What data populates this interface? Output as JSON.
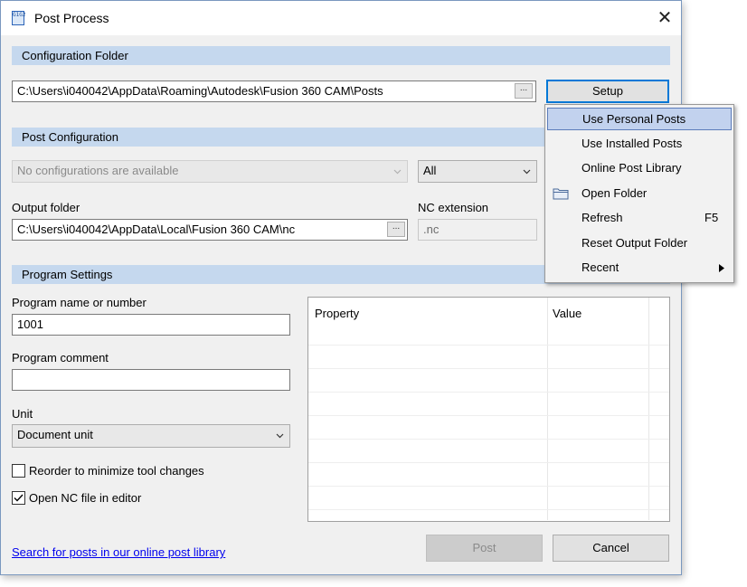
{
  "window": {
    "title": "Post Process",
    "close_glyph": "✕",
    "icon": "post-process-app-icon",
    "icon_text": "G1G2"
  },
  "config_folder": {
    "header": "Configuration Folder",
    "path": "C:\\Users\\i040042\\AppData\\Roaming\\Autodesk\\Fusion 360 CAM\\Posts",
    "browse_label": "...",
    "setup_label": "Setup"
  },
  "post_config": {
    "header": "Post Configuration",
    "config_select": "No configurations are available",
    "filter_select": "All",
    "output_folder_label": "Output folder",
    "output_folder": "C:\\Users\\i040042\\AppData\\Local\\Fusion 360 CAM\\nc",
    "browse_label": "...",
    "nc_extension_label": "NC extension",
    "nc_extension": ".nc"
  },
  "program_settings": {
    "header": "Program Settings",
    "name_label": "Program name or number",
    "name_value": "1001",
    "comment_label": "Program comment",
    "comment_value": "",
    "unit_label": "Unit",
    "unit_value": "Document unit",
    "reorder_label": "Reorder to minimize tool changes",
    "reorder_checked": false,
    "open_nc_label": "Open NC file in editor",
    "open_nc_checked": true
  },
  "property_grid": {
    "columns": [
      "Property",
      "Value"
    ]
  },
  "setup_menu": {
    "items": [
      {
        "label": "Use Personal Posts",
        "highlighted": true
      },
      {
        "label": "Use Installed Posts"
      },
      {
        "label": "Online Post Library"
      },
      {
        "label": "Open Folder",
        "icon": "folder-icon"
      },
      {
        "label": "Refresh",
        "shortcut": "F5"
      },
      {
        "label": "Reset Output Folder"
      },
      {
        "label": "Recent",
        "submenu": true
      }
    ]
  },
  "footer": {
    "link": "Search for posts in our online post library",
    "post_label": "Post",
    "cancel_label": "Cancel"
  },
  "colors": {
    "section_header": "#c5d8ee",
    "dialog_bg": "#f0f0f0",
    "focus_border": "#0078d7",
    "menu_highlight": "#c2d2ee"
  }
}
